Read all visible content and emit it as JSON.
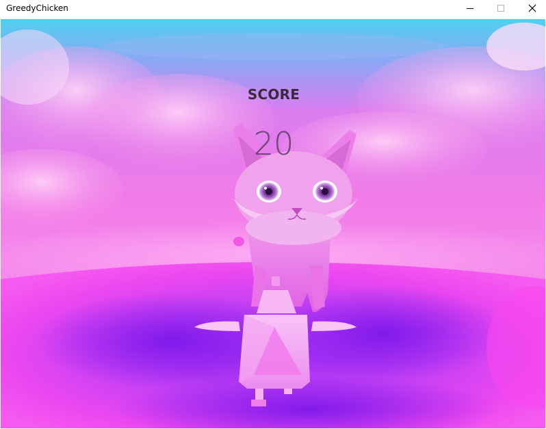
{
  "window": {
    "title": "GreedyChicken"
  },
  "hud": {
    "score_label": "SCORE",
    "score_value": "20"
  },
  "colors": {
    "sky_top": "#5ad0f0",
    "sky_pink": "#f070e8",
    "ground_magenta": "#f040f0",
    "ground_purple": "#8a20f0",
    "cat_pink": "#f078e0",
    "chicken_pink": "#f5a0f0",
    "score_text": "#3a2a3e"
  },
  "icons": {
    "minimize": "minimize-icon",
    "maximize": "maximize-icon",
    "close": "close-icon"
  }
}
